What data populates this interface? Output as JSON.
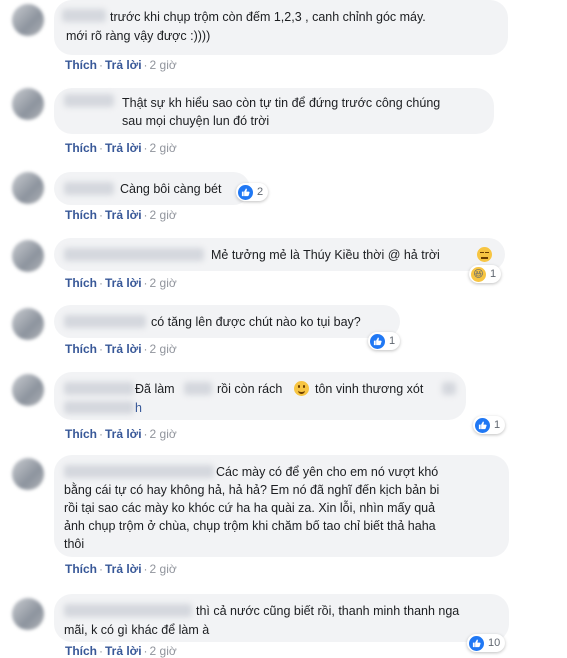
{
  "actions": {
    "like": "Thích",
    "reply": "Trả lời",
    "sep": "·"
  },
  "comments": [
    {
      "line1": "trước khi chụp trộm còn đếm 1,2,3 , canh chỉnh góc máy.",
      "line2": "mới rõ ràng vậy được :))))",
      "time": "2 giờ"
    },
    {
      "line1": "Thật sự kh hiểu sao còn tự tin để đứng trước công chúng",
      "line2": "sau mọi chuyện lun đó trời",
      "time": "2 giờ"
    },
    {
      "line1": "Càng bôi càng bét",
      "time": "2 giờ",
      "reaction_count": "2"
    },
    {
      "line1": "Mẻ tưởng mẻ là Thúy Kiều thời @ hả trời",
      "time": "2 giờ",
      "reaction_count": "1"
    },
    {
      "line1": "có tăng lên được chút nào ko tụi bay?",
      "time": "2 giờ",
      "reaction_count": "1"
    },
    {
      "line1a": "Đã làm",
      "line1b": "rồi còn rách",
      "line1c": "tôn vinh thương xót",
      "line2": "h",
      "time": "2 giờ",
      "reaction_count": "1"
    },
    {
      "line1": "Các mày có để yên cho em nó vượt khó",
      "line2": "bằng cái tự có hay không hả, hả hả? Em nó đã nghĩ đến kịch bản bi",
      "line3": "rồi tại sao các mày ko khóc cứ ha ha quài za. Xin lỗi, nhìn mấy quả",
      "line4": "ảnh chụp trộm ở chùa, chụp trộm khi chăm bố tao chỉ biết thả haha",
      "line5": "thôi",
      "time": "2 giờ"
    },
    {
      "line1": "thì cả nước cũng biết rồi, thanh minh thanh nga",
      "line2": "mãi, k có gì khác để làm à",
      "time": "2 giờ",
      "reaction_count": "10"
    }
  ]
}
